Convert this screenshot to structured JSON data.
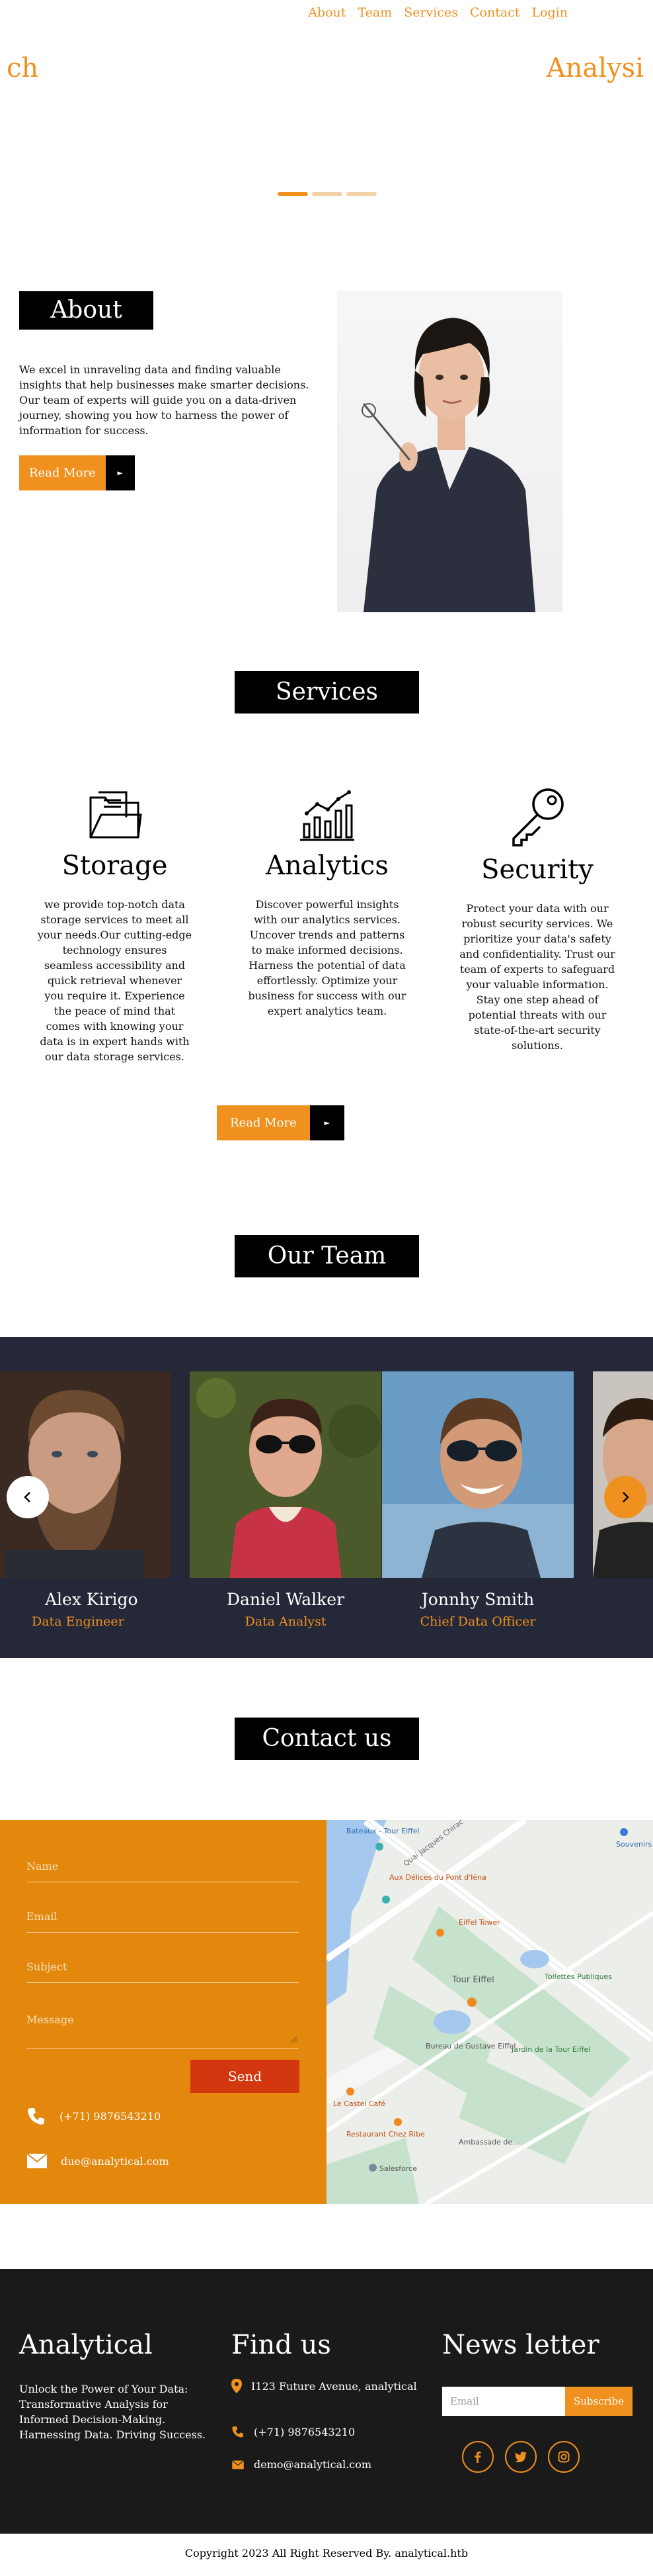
{
  "nav": {
    "items": [
      "About",
      "Team",
      "Services",
      "Contact",
      "Login"
    ]
  },
  "hero": {
    "left_text": "ch",
    "right_text": "Analysi"
  },
  "about": {
    "title": "About",
    "text": "We excel in unraveling data and finding valuable insights that help businesses make smarter decisions. Our team of experts will guide you on a data-driven journey, showing you how to harness the power of information for success.",
    "button": "Read More"
  },
  "services": {
    "title": "Services",
    "items": [
      {
        "title": "Storage",
        "icon": "folder-icon",
        "text": "we provide top-notch data storage services to meet all your needs.Our cutting-edge technology ensures seamless accessibility and quick retrieval whenever you require it. Experience the peace of mind that comes with knowing your data is in expert hands with our data storage services."
      },
      {
        "title": "Analytics",
        "icon": "chart-icon",
        "text": "Discover powerful insights with our analytics services. Uncover trends and patterns to make informed decisions. Harness the potential of data effortlessly. Optimize your business for success with our expert analytics team."
      },
      {
        "title": "Security",
        "icon": "key-icon",
        "text": "Protect your data with our robust security services. We prioritize your data's safety and confidentiality. Trust our team of experts to safeguard your valuable information. Stay one step ahead of potential threats with our state-of-the-art security solutions."
      }
    ],
    "button": "Read More"
  },
  "team": {
    "title": "Our Team",
    "members": [
      {
        "name": "Alex Kirigo",
        "role": "Data Engineer"
      },
      {
        "name": "Daniel Walker",
        "role": "Data Analyst"
      },
      {
        "name": "Jonnhy Smith",
        "role": "Chief Data Officer"
      }
    ]
  },
  "contact": {
    "title": "Contact us",
    "fields": {
      "name": "Name",
      "email": "Email",
      "subject": "Subject",
      "message": "Message"
    },
    "send": "Send",
    "phone": "(+71) 9876543210",
    "email": "due@analytical.com",
    "map_labels": [
      "Bateaux - Tour Eiffel",
      "Aux Délices du Pont d'Iéna",
      "Tour Eiffel",
      "Bureau de Gustave Eiffel",
      "Jardin de la Tour Eiffel",
      "Eiffel Tower",
      "Le Castel Café",
      "Restaurant Chez Ribe",
      "Salesforce",
      "Souvenirs",
      "Toilettes Publiques",
      "Ambassade de...",
      "Quai Jacques Chirac"
    ]
  },
  "footer": {
    "brand": "Analytical",
    "tagline": "Unlock the Power of Your Data: Transformative Analysis for Informed Decision-Making. Harnessing Data. Driving Success.",
    "find_title": "Find us",
    "address": "I123 Future Avenue, analytical",
    "phone": "(+71) 9876543210",
    "email": "demo@analytical.com",
    "news_title": "News letter",
    "newsletter_placeholder": "Email",
    "subscribe": "Subscribe",
    "socials": [
      "facebook-icon",
      "twitter-icon",
      "instagram-icon"
    ],
    "copyright": "Copyright 2023 All Right Reserved By. analytical.htb"
  },
  "colors": {
    "accent": "#f0901f",
    "form": "#e3870d",
    "send": "#d2370f",
    "band": "#252838",
    "footer": "#1a1a1a"
  }
}
